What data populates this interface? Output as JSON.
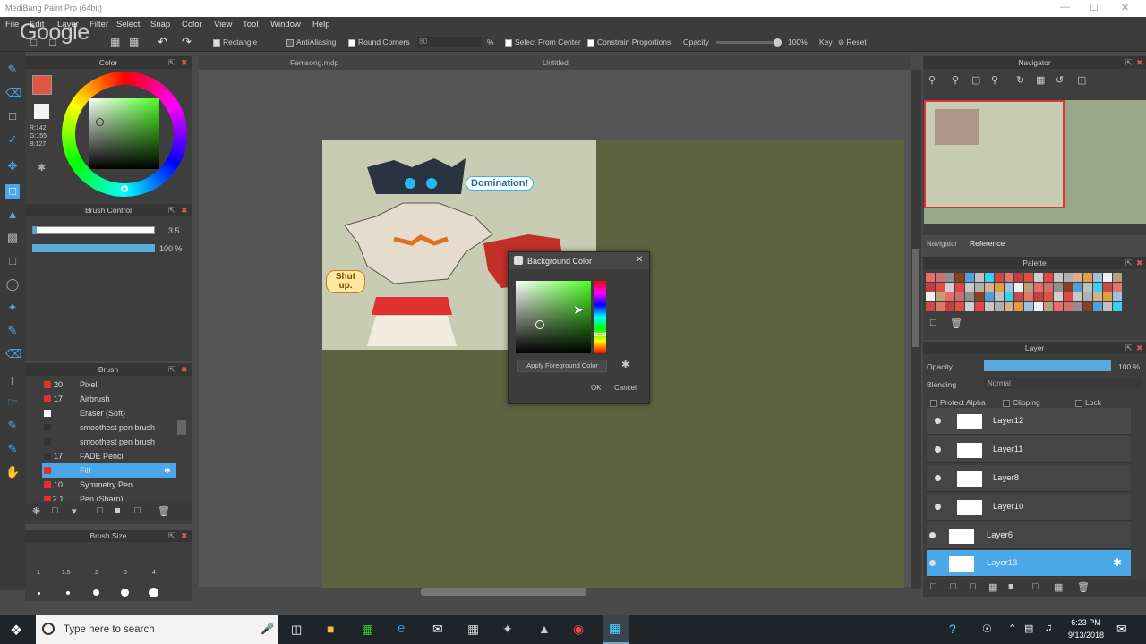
{
  "window": {
    "title": "MediBang Paint Pro (64bit)"
  },
  "watermark": "Google",
  "menu": [
    "File",
    "Edit",
    "Layer",
    "Filter",
    "Select",
    "Snap",
    "Color",
    "View",
    "Tool",
    "Window",
    "Help"
  ],
  "toolbar": {
    "shape": "Rectangle",
    "antialias": "AntiAliasing",
    "round_corners": "Round Corners",
    "round_value": "80",
    "percent": "%",
    "select_from_center": "Select From Center",
    "constrain": "Constrain Proportions",
    "opacity_label": "Opacity",
    "opacity_value": "100%",
    "key": "Key",
    "reset": "Reset"
  },
  "tabs": [
    "Femsong.mdp",
    "Untitled"
  ],
  "color_panel": {
    "title": "Color",
    "values": [
      "R:142",
      "G:155",
      "B:127"
    ]
  },
  "brush_control": {
    "title": "Brush Control",
    "size": "3.5",
    "opacity": "100 %"
  },
  "brush_panel": {
    "title": "Brush",
    "items": [
      {
        "num": "20",
        "name": "Pixel",
        "color": "#e03030"
      },
      {
        "num": "17",
        "name": "Airbrush",
        "color": "#e03030"
      },
      {
        "num": "",
        "name": "Eraser (Soft)",
        "color": "#ffffff"
      },
      {
        "num": "",
        "name": "smoothest pen brush",
        "color": "#e03030"
      },
      {
        "num": "",
        "name": "smoothest pen brush",
        "color": "#e03030"
      },
      {
        "num": "17",
        "name": "FADE Pencil",
        "color": "#333333"
      },
      {
        "num": "",
        "name": "Fill",
        "color": "#e03030"
      },
      {
        "num": "10",
        "name": "Symmetry Pen",
        "color": "#e03030"
      },
      {
        "num": "2.1",
        "name": "Pen (Sharp)",
        "color": "#e03030"
      }
    ]
  },
  "brush_size": {
    "title": "Brush Size",
    "sizes": [
      "1",
      "1.5",
      "2",
      "3",
      "4"
    ]
  },
  "navigator": {
    "title": "Navigator",
    "tabs": [
      "Navigator",
      "Reference"
    ]
  },
  "palette": {
    "title": "Palette"
  },
  "layer_panel": {
    "title": "Layer",
    "opacity_label": "Opacity",
    "opacity_value": "100 %",
    "blending_label": "Blending",
    "blending_value": "Normal",
    "protect_alpha": "Protect Alpha",
    "clipping": "Clipping",
    "lock": "Lock",
    "layers": [
      "Layer12",
      "Layer11",
      "Layer8",
      "Layer10",
      "Layer6",
      "Layer13"
    ]
  },
  "art": {
    "bubble1": "Domination!",
    "bubble2": "Shut up."
  },
  "dialog": {
    "title": "Background Color",
    "apply": "Apply Foreground Color",
    "ok": "OK",
    "cancel": "Cancel"
  },
  "taskbar": {
    "search": "Type here to search",
    "time": "6:23 PM",
    "date": "9/13/2018"
  }
}
